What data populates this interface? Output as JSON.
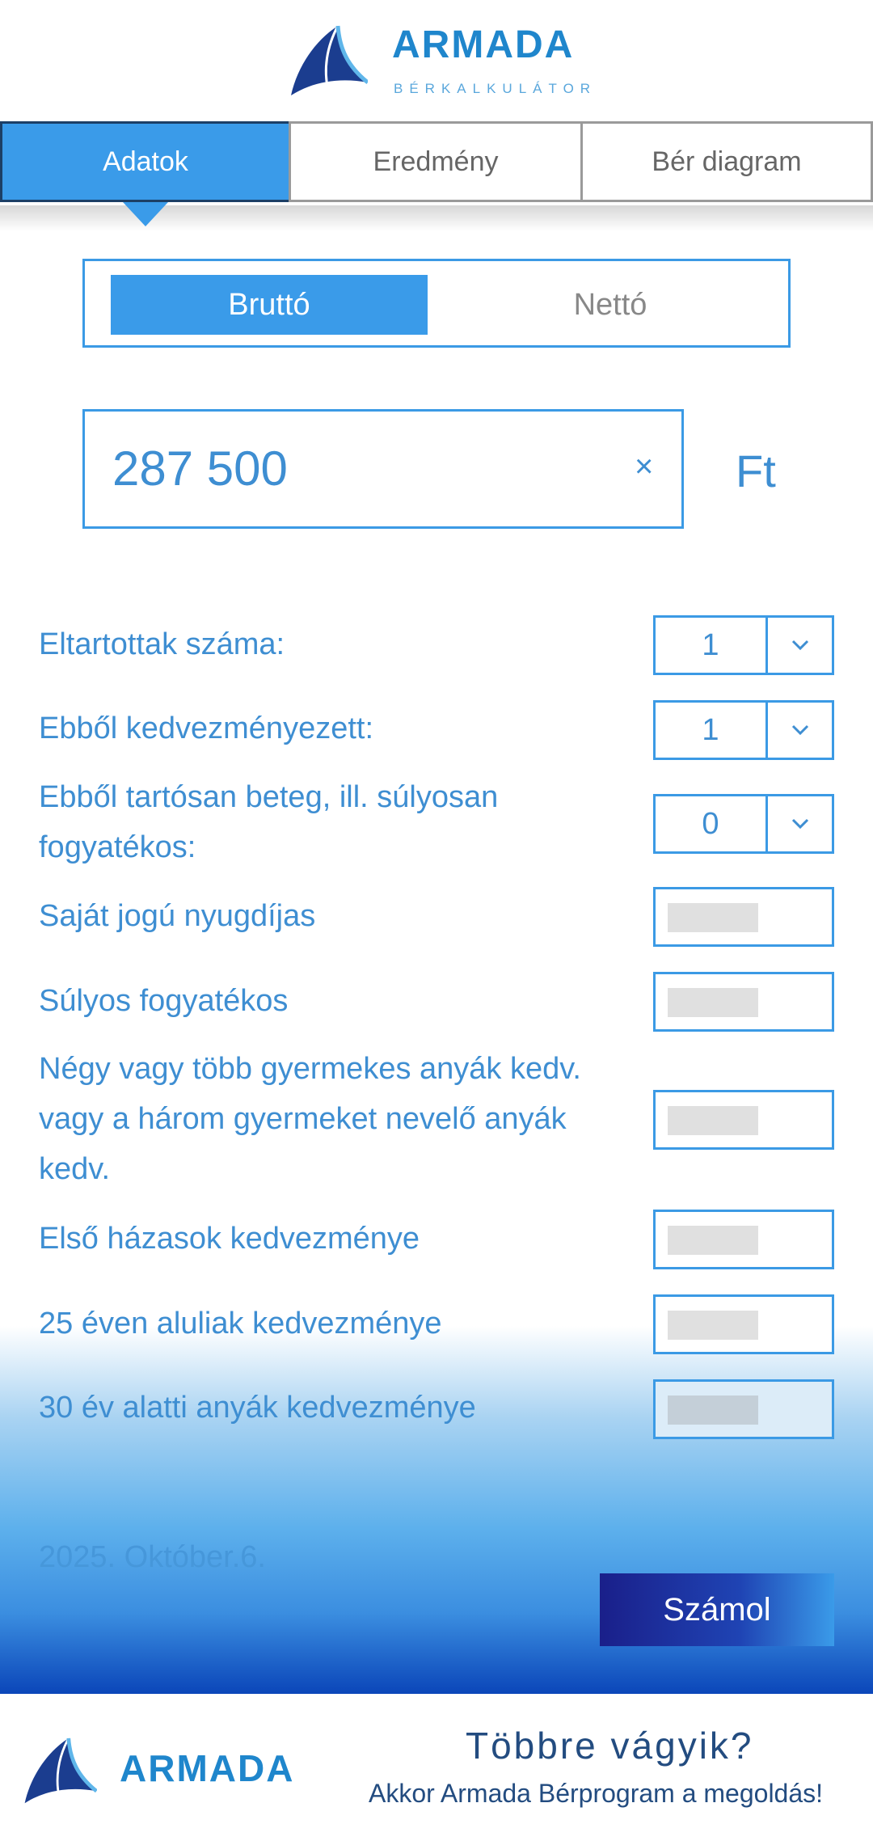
{
  "header": {
    "logo_word": "ARMADA",
    "logo_sub": "BÉRKALKULÁTOR"
  },
  "tabs": [
    {
      "label": "Adatok",
      "active": true
    },
    {
      "label": "Eredmény",
      "active": false
    },
    {
      "label": "Bér diagram",
      "active": false
    }
  ],
  "mode_toggle": {
    "options": [
      "Bruttó",
      "Nettó"
    ],
    "selected": "Bruttó"
  },
  "amount": {
    "value": "287 500",
    "clear": "×",
    "currency": "Ft"
  },
  "fields": {
    "dependents": {
      "label": "Eltartottak száma:",
      "value": "1"
    },
    "beneficiaries": {
      "label": "Ebből kedvezményezett:",
      "value": "1"
    },
    "disabled": {
      "label": "Ebből tartósan beteg, ill. súlyosan fogyatékos:",
      "value": "0"
    }
  },
  "toggles": [
    "Saját jogú nyugdíjas",
    "Súlyos fogyatékos",
    "Négy vagy több gyermekes anyák kedv. vagy a három gyermeket nevelő anyák kedv.",
    "Első házasok kedvezménye",
    "25 éven aluliak kedvezménye",
    "30 év alatti anyák kedvezménye"
  ],
  "date": "2025. Október.6.",
  "calc_button": "Számol",
  "footer": {
    "logo_word": "ARMADA",
    "question": "Többre vágyik?",
    "subtitle": "Akkor Armada Bérprogram a megoldás!"
  },
  "colors": {
    "accent": "#3a9be9",
    "text_blue": "#3e8ed2",
    "dark_navy": "#1a1f8a"
  }
}
